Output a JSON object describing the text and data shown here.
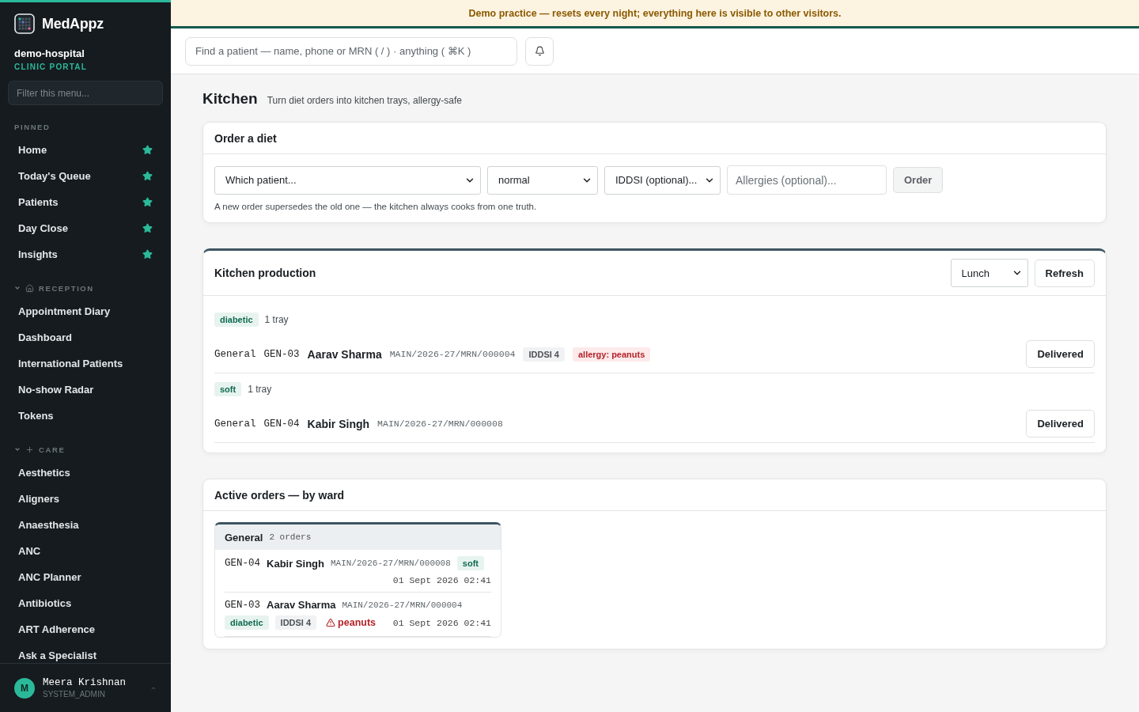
{
  "brand": {
    "name": "MedAppz",
    "tenant": "demo-hospital",
    "portal": "CLINIC PORTAL"
  },
  "menu_filter": {
    "placeholder": "Filter this menu..."
  },
  "nav_sections": [
    {
      "title": "PINNED",
      "kind": "pinned",
      "items": [
        {
          "label": "Home",
          "pinned": true
        },
        {
          "label": "Today's Queue",
          "pinned": true
        },
        {
          "label": "Patients",
          "pinned": true
        },
        {
          "label": "Day Close",
          "pinned": true
        },
        {
          "label": "Insights",
          "pinned": true
        }
      ]
    },
    {
      "title": "RECEPTION",
      "kind": "reception",
      "expanded": true,
      "items": [
        {
          "label": "Appointment Diary",
          "pinned": false
        },
        {
          "label": "Dashboard",
          "pinned": false
        },
        {
          "label": "International Patients",
          "pinned": false
        },
        {
          "label": "No-show Radar",
          "pinned": false
        },
        {
          "label": "Tokens",
          "pinned": false
        }
      ]
    },
    {
      "title": "CARE",
      "kind": "care",
      "expanded": true,
      "items": [
        {
          "label": "Aesthetics",
          "pinned": false
        },
        {
          "label": "Aligners",
          "pinned": false
        },
        {
          "label": "Anaesthesia",
          "pinned": false
        },
        {
          "label": "ANC",
          "pinned": false
        },
        {
          "label": "ANC Planner",
          "pinned": false
        },
        {
          "label": "Antibiotics",
          "pinned": false
        },
        {
          "label": "ART Adherence",
          "pinned": false
        },
        {
          "label": "Ask a Specialist",
          "pinned": false
        }
      ]
    }
  ],
  "user": {
    "initial": "M",
    "name": "Meera Krishnan",
    "role": "SYSTEM_ADMIN"
  },
  "banner": "Demo practice — resets every night; everything here is visible to other visitors.",
  "search": {
    "placeholder": "Find a patient — name, phone or MRN ( / ) · anything ( ⌘K )"
  },
  "page": {
    "title": "Kitchen",
    "subtitle": "Turn diet orders into kitchen trays, allergy-safe"
  },
  "order_form": {
    "title": "Order a diet",
    "patient": "Which patient...",
    "diet": "normal",
    "iddsi": "IDDSI (optional)...",
    "allergies_placeholder": "Allergies (optional)...",
    "button": "Order",
    "hint": "A new order supersedes the old one — the kitchen always cooks from one truth."
  },
  "production": {
    "title": "Kitchen production",
    "meal": "Lunch",
    "refresh": "Refresh",
    "groups": [
      {
        "diet": "diabetic",
        "count": "1 tray",
        "rows": [
          {
            "ward": "General",
            "bed": "GEN-03",
            "name": "Aarav Sharma",
            "mrn": "MAIN/2026-27/MRN/000004",
            "tags": [
              {
                "kind": "iddsi",
                "text": "IDDSI 4"
              },
              {
                "kind": "allergy",
                "text": "allergy: peanuts"
              }
            ],
            "action": "Delivered"
          }
        ]
      },
      {
        "diet": "soft",
        "count": "1 tray",
        "rows": [
          {
            "ward": "General",
            "bed": "GEN-04",
            "name": "Kabir Singh",
            "mrn": "MAIN/2026-27/MRN/000008",
            "tags": [],
            "action": "Delivered"
          }
        ]
      }
    ]
  },
  "active": {
    "title": "Active orders — by ward",
    "wards": [
      {
        "name": "General",
        "count": "2 orders",
        "orders": [
          {
            "bed": "GEN-04",
            "name": "Kabir Singh",
            "mrn": "MAIN/2026-27/MRN/000008",
            "tags": [
              {
                "kind": "diet",
                "text": "soft"
              }
            ],
            "time": "01 Sept 2026 02:41"
          },
          {
            "bed": "GEN-03",
            "name": "Aarav Sharma",
            "mrn": "MAIN/2026-27/MRN/000004",
            "tags": [
              {
                "kind": "diet",
                "text": "diabetic"
              },
              {
                "kind": "iddsi",
                "text": "IDDSI 4"
              },
              {
                "kind": "allergy_warning",
                "text": "peanuts"
              }
            ],
            "time": "01 Sept 2026 02:41"
          }
        ]
      }
    ]
  }
}
